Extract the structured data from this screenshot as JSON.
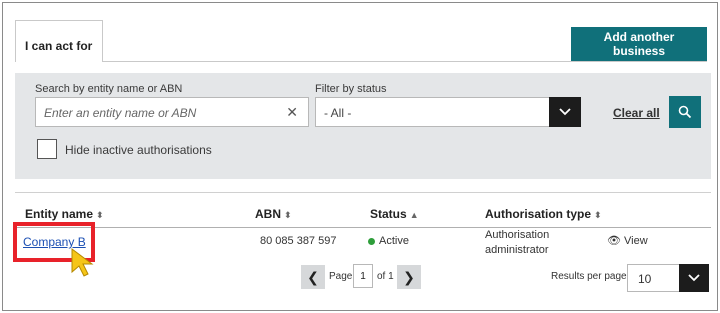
{
  "tabs": {
    "active_label": "I can act for"
  },
  "header": {
    "add_button_label": "Add another business"
  },
  "filters": {
    "search_label": "Search by entity name or ABN",
    "search_placeholder": "Enter an entity name or ABN",
    "status_label": "Filter by status",
    "status_selected": "- All -",
    "clear_all_label": "Clear all",
    "hide_inactive_label": "Hide inactive authorisations"
  },
  "table": {
    "columns": [
      "Entity name",
      "ABN",
      "Status",
      "Authorisation type"
    ],
    "rows": [
      {
        "entity": "Company B",
        "abn": "80 085 387 597",
        "status": "Active",
        "auth_type_line1": "Authorisation",
        "auth_type_line2": "administrator",
        "action": "View"
      }
    ]
  },
  "pagination": {
    "page_label": "Page",
    "current_page": "1",
    "of_label": "of 1",
    "results_per_page_label": "Results per page",
    "results_per_page_value": "10"
  },
  "colors": {
    "accent": "#10707a",
    "highlight": "#e8222a",
    "link": "#1b4fb3",
    "active": "#2e9e3a"
  },
  "icons": [
    "close-icon",
    "chevron-down-icon",
    "search-icon",
    "sort-icon",
    "eye-icon",
    "chevron-left-icon",
    "chevron-right-icon",
    "pointer-cursor-icon"
  ]
}
